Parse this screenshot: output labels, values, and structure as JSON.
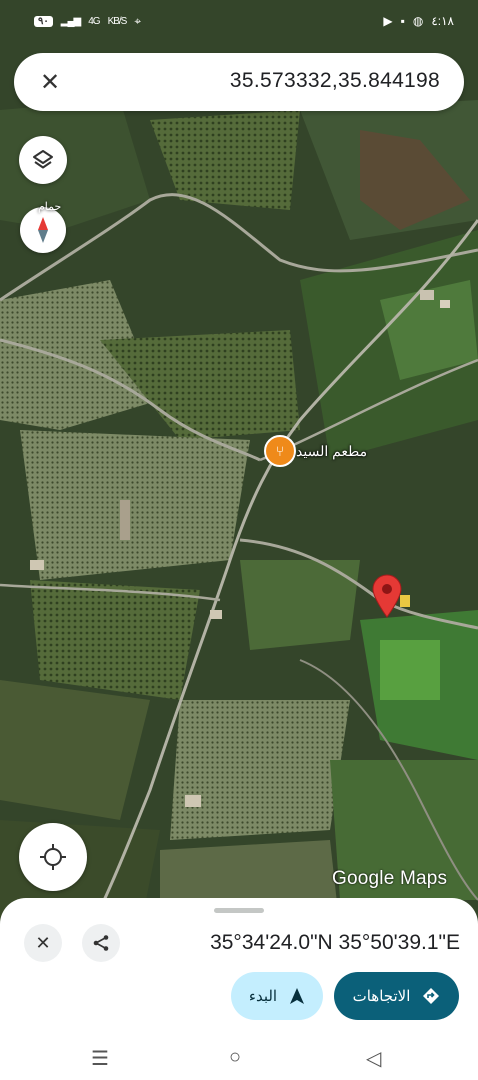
{
  "status_bar": {
    "battery": "٩٠",
    "network": "4G",
    "speed": "KB/S",
    "time": "٤:١٨"
  },
  "search": {
    "query": "35.573332,35.844198"
  },
  "map": {
    "poi_name": "مطعم السيد",
    "place_label": "حمام",
    "attribution": "Google Maps"
  },
  "sheet": {
    "coordinates_dms": "35°34'24.0\"N 35°50'39.1\"E",
    "directions_label": "الاتجاهات",
    "start_label": "البدء"
  },
  "icons": {
    "close": "close-icon",
    "layers": "layers-icon",
    "compass": "compass-icon",
    "my_location": "my-location-icon",
    "share": "share-icon",
    "restaurant": "restaurant-icon",
    "pin": "red-pin-icon",
    "directions": "directions-icon",
    "navigation": "navigation-arrow-icon"
  },
  "colors": {
    "accent": "#0b6079",
    "start_pill": "#c4eefe",
    "pin": "#e53935",
    "poi": "#ef8a1a"
  }
}
